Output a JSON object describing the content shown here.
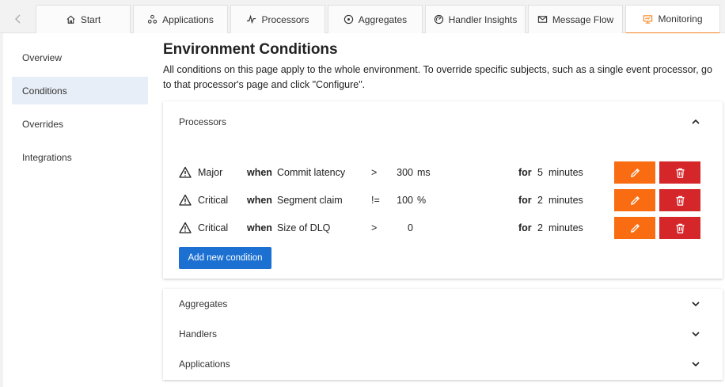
{
  "tabs": [
    {
      "label": "Start",
      "icon": "home-icon"
    },
    {
      "label": "Applications",
      "icon": "applications-icon"
    },
    {
      "label": "Processors",
      "icon": "processors-icon"
    },
    {
      "label": "Aggregates",
      "icon": "aggregates-icon"
    },
    {
      "label": "Handler Insights",
      "icon": "insights-icon"
    },
    {
      "label": "Message Flow",
      "icon": "message-flow-icon"
    },
    {
      "label": "Monitoring",
      "icon": "monitoring-icon",
      "active": true
    }
  ],
  "sidebar": {
    "items": [
      {
        "label": "Overview"
      },
      {
        "label": "Conditions",
        "active": true
      },
      {
        "label": "Overrides"
      },
      {
        "label": "Integrations"
      }
    ]
  },
  "page": {
    "title": "Environment Conditions",
    "description": "All conditions on this page apply to the whole environment. To override specific subjects, such as a single event processor, go to that processor's page and click \"Configure\"."
  },
  "processors": {
    "title": "Processors",
    "conditions": [
      {
        "severity": "Major",
        "when": "when",
        "metric": "Commit latency",
        "operator": ">",
        "value": "300",
        "unit": "ms",
        "for": "for",
        "duration": "5",
        "duration_unit": "minutes"
      },
      {
        "severity": "Critical",
        "when": "when",
        "metric": "Segment claim",
        "operator": "!=",
        "value": "100",
        "unit": "%",
        "for": "for",
        "duration": "2",
        "duration_unit": "minutes"
      },
      {
        "severity": "Critical",
        "when": "when",
        "metric": "Size of DLQ",
        "operator": ">",
        "value": "0",
        "unit": "",
        "for": "for",
        "duration": "2",
        "duration_unit": "minutes"
      }
    ],
    "add_label": "Add new condition"
  },
  "other_sections": {
    "aggregates": "Aggregates",
    "handlers": "Handlers",
    "applications": "Applications"
  },
  "colors": {
    "accent_tab": "#f5821f",
    "edit_button": "#f96c12",
    "delete_button": "#d5262a",
    "primary_button": "#1b70d2",
    "sidebar_active": "#e8eef7"
  }
}
